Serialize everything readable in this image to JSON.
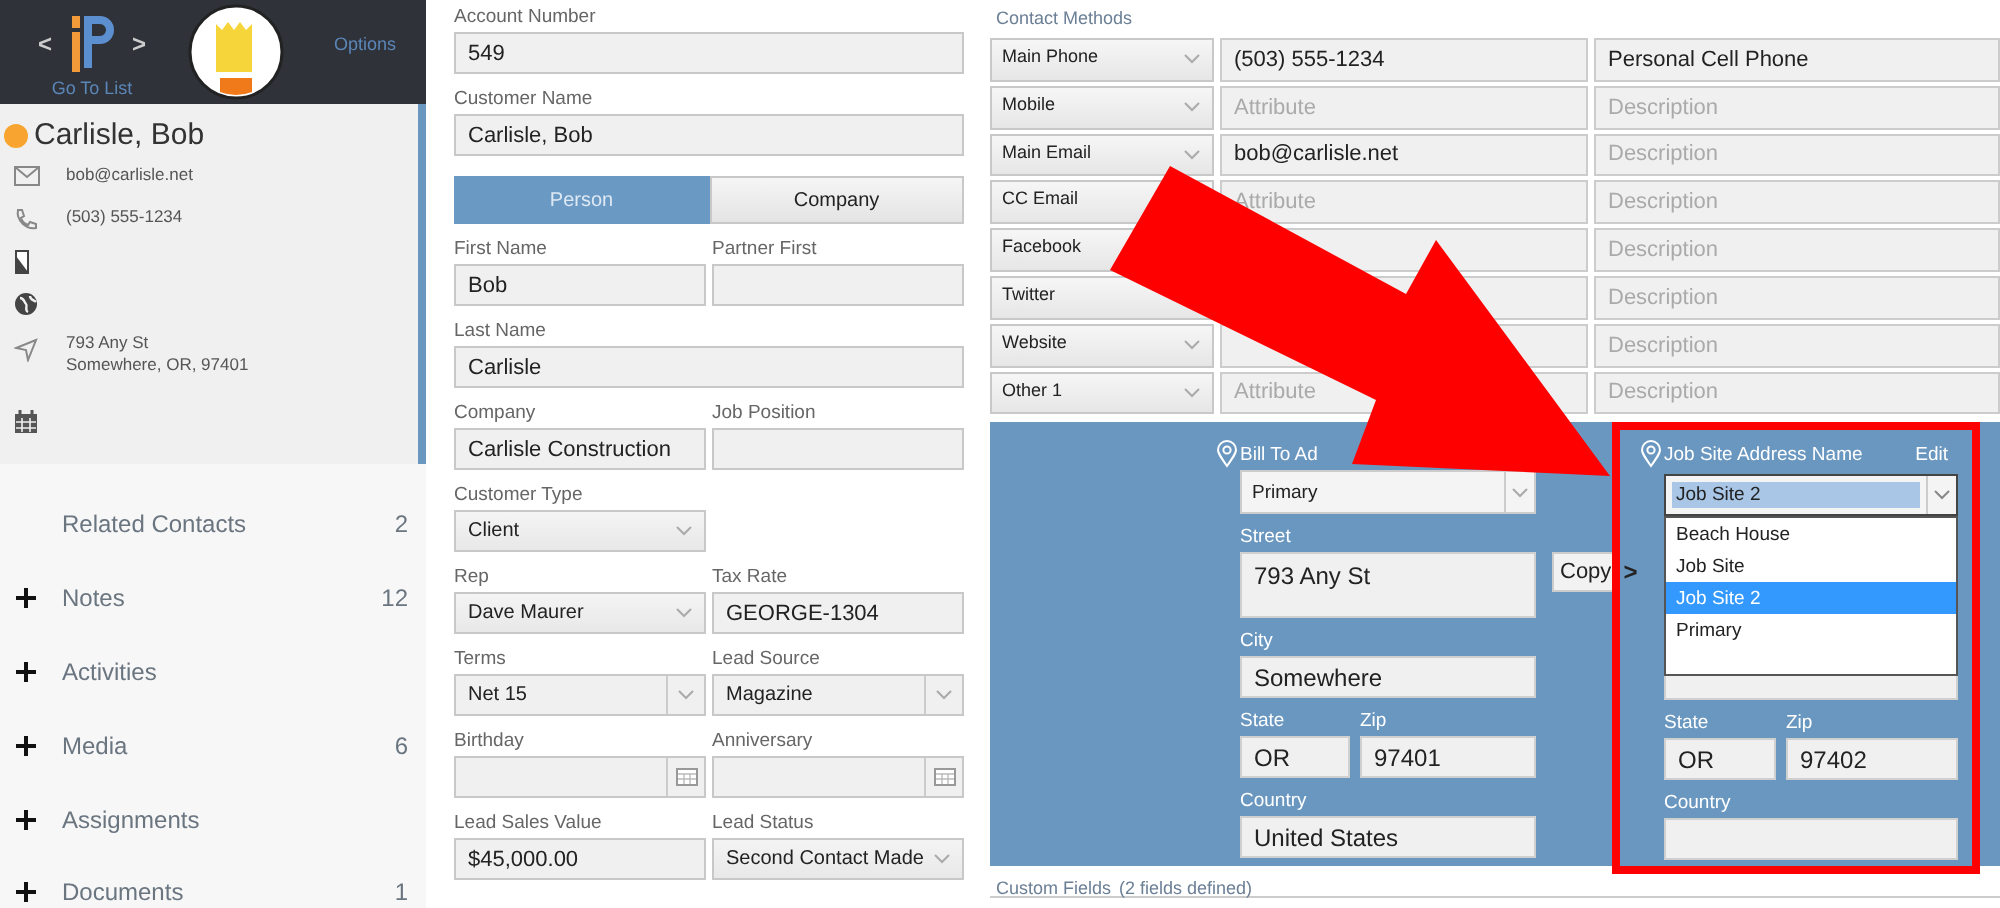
{
  "header": {
    "prev": "<",
    "next": ">",
    "go_to_list": "Go To List",
    "options": "Options"
  },
  "contact": {
    "name": "Carlisle, Bob",
    "details": [
      {
        "kind": "email",
        "lines": [
          "bob@carlisle.net"
        ]
      },
      {
        "kind": "phone",
        "lines": [
          "(503) 555-1234"
        ]
      },
      {
        "kind": "mobile"
      },
      {
        "kind": "web"
      },
      {
        "kind": "location",
        "lines": [
          "793 Any St",
          "Somewhere, OR, 97401"
        ]
      },
      {
        "kind": "calendar"
      }
    ]
  },
  "sections": [
    {
      "label": "Related Contacts",
      "count": "2",
      "expandable": false
    },
    {
      "label": "Notes",
      "count": "12",
      "expandable": true
    },
    {
      "label": "Activities",
      "expandable": true
    },
    {
      "label": "Media",
      "count": "6",
      "expandable": true
    },
    {
      "label": "Assignments",
      "expandable": true
    },
    {
      "label": "Documents",
      "count": "1",
      "expandable": true
    }
  ],
  "form": [
    {
      "fields": [
        {
          "label": "Account Number",
          "kind": "text",
          "value": "549",
          "wide": true
        }
      ]
    },
    {
      "fields": [
        {
          "label": "Customer Name",
          "kind": "text",
          "value": "Carlisle, Bob",
          "wide": true
        }
      ]
    },
    {
      "fields": [
        {
          "kind": "toggle",
          "wide": true,
          "options": [
            {
              "label": "Person",
              "selected": true
            },
            {
              "label": "Company",
              "selected": false
            }
          ]
        }
      ]
    },
    {
      "fields": [
        {
          "label": "First Name",
          "kind": "text",
          "value": "Bob"
        },
        {
          "label": "Partner First",
          "kind": "text"
        }
      ]
    },
    {
      "fields": [
        {
          "label": "Last Name",
          "kind": "text",
          "value": "Carlisle",
          "wide": true
        }
      ]
    },
    {
      "fields": [
        {
          "label": "Company",
          "kind": "text",
          "value": "Carlisle Construction"
        },
        {
          "label": "Job Position",
          "kind": "text"
        }
      ]
    },
    {
      "fields": [
        {
          "label": "Customer Type",
          "kind": "select",
          "value": "Client"
        }
      ]
    },
    {
      "fields": [
        {
          "label": "Rep",
          "kind": "select",
          "value": "Dave Maurer"
        },
        {
          "label": "Tax Rate",
          "kind": "text",
          "value": "GEORGE-1304"
        }
      ]
    },
    {
      "fields": [
        {
          "label": "Terms",
          "kind": "combo",
          "value": "Net 15"
        },
        {
          "label": "Lead Source",
          "kind": "combo",
          "value": "Magazine"
        }
      ]
    },
    {
      "fields": [
        {
          "label": "Birthday",
          "kind": "date"
        },
        {
          "label": "Anniversary",
          "kind": "date"
        }
      ]
    },
    {
      "fields": [
        {
          "label": "Lead Sales Value",
          "kind": "text",
          "value": "$45,000.00"
        },
        {
          "label": "Lead Status",
          "kind": "select",
          "value": "Second Contact Made"
        }
      ]
    }
  ],
  "contact_methods": {
    "title": "Contact Methods",
    "rows": [
      {
        "type": "Main Phone",
        "attribute": "(503) 555-1234",
        "description": "Personal Cell Phone"
      },
      {
        "type": "Mobile",
        "attribute_placeholder": "Attribute",
        "description_placeholder": "Description"
      },
      {
        "type": "Main Email",
        "attribute": "bob@carlisle.net",
        "description_placeholder": "Description"
      },
      {
        "type": "CC Email",
        "attribute_placeholder": "Attribute",
        "description_placeholder": "Description"
      },
      {
        "type": "Facebook",
        "description_placeholder": "Description"
      },
      {
        "type": "Twitter",
        "description_placeholder": "Description"
      },
      {
        "type": "Website",
        "description_placeholder": "Description"
      },
      {
        "type": "Other 1",
        "attribute_placeholder": "Attribute",
        "description_placeholder": "Description"
      }
    ]
  },
  "bill_to": {
    "label": "Bill To Ad",
    "name": "Primary",
    "street_label": "Street",
    "street": "793 Any St",
    "city_label": "City",
    "city": "Somewhere",
    "state_label": "State",
    "state": "OR",
    "zip_label": "Zip",
    "zip": "97401",
    "country_label": "Country",
    "country": "United States"
  },
  "copy_button": {
    "label": "Copy",
    "arrow": ">"
  },
  "job_site": {
    "label": "Job Site Address Name",
    "edit": "Edit",
    "name": "Job Site 2",
    "dropdown_open": true,
    "options": [
      {
        "label": "Beach House",
        "selected": false
      },
      {
        "label": "Job Site",
        "selected": false
      },
      {
        "label": "Job Site 2",
        "selected": true
      },
      {
        "label": "Primary",
        "selected": false
      }
    ],
    "state_label": "State",
    "state": "OR",
    "zip_label": "Zip",
    "zip": "97402",
    "country_label": "Country"
  },
  "custom_fields": {
    "title": "Custom Fields",
    "count": "(2 fields defined)"
  },
  "annotation": {
    "arrow": true,
    "highlight": true
  }
}
